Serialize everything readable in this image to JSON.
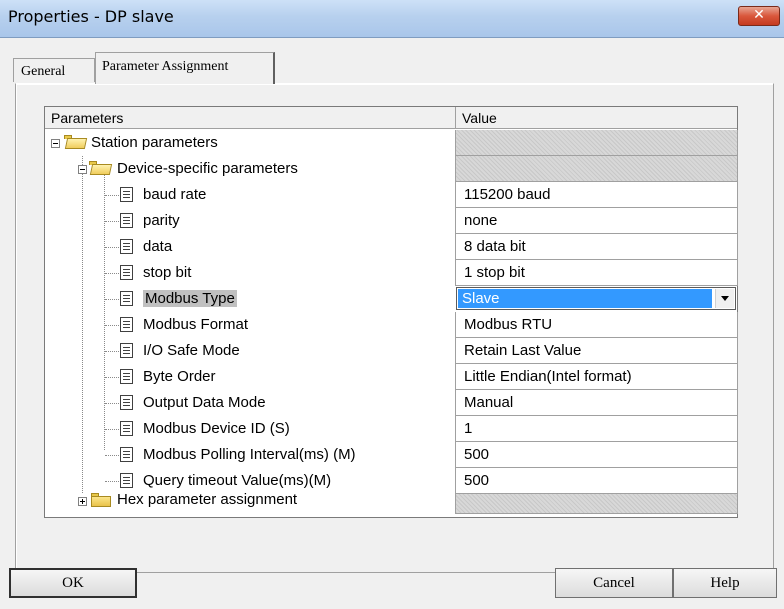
{
  "window": {
    "title": "Properties - DP slave",
    "close_glyph": "✕"
  },
  "tabs": [
    {
      "label": "General"
    },
    {
      "label": "Parameter Assignment"
    }
  ],
  "grid": {
    "columns": {
      "params": "Parameters",
      "value": "Value"
    },
    "rows": [
      {
        "label": "Station parameters",
        "value": ""
      },
      {
        "label": "Device-specific parameters",
        "value": ""
      },
      {
        "label": "baud rate",
        "value": "115200 baud"
      },
      {
        "label": "parity",
        "value": "none"
      },
      {
        "label": "data",
        "value": "8 data bit"
      },
      {
        "label": "stop bit",
        "value": "1 stop bit"
      },
      {
        "label": "Modbus Type",
        "value": "Slave"
      },
      {
        "label": "Modbus Format",
        "value": "Modbus RTU"
      },
      {
        "label": "I/O Safe Mode",
        "value": "Retain Last Value"
      },
      {
        "label": "Byte Order",
        "value": "Little Endian(Intel format)"
      },
      {
        "label": "Output Data Mode",
        "value": "Manual"
      },
      {
        "label": "Modbus Device ID (S)",
        "value": "1"
      },
      {
        "label": "Modbus Polling Interval(ms) (M)",
        "value": "500"
      },
      {
        "label": "Query timeout Value(ms)(M)",
        "value": "500"
      },
      {
        "label": "Hex parameter assignment",
        "value": ""
      }
    ]
  },
  "buttons": {
    "ok": "OK",
    "cancel": "Cancel",
    "help": "Help"
  }
}
